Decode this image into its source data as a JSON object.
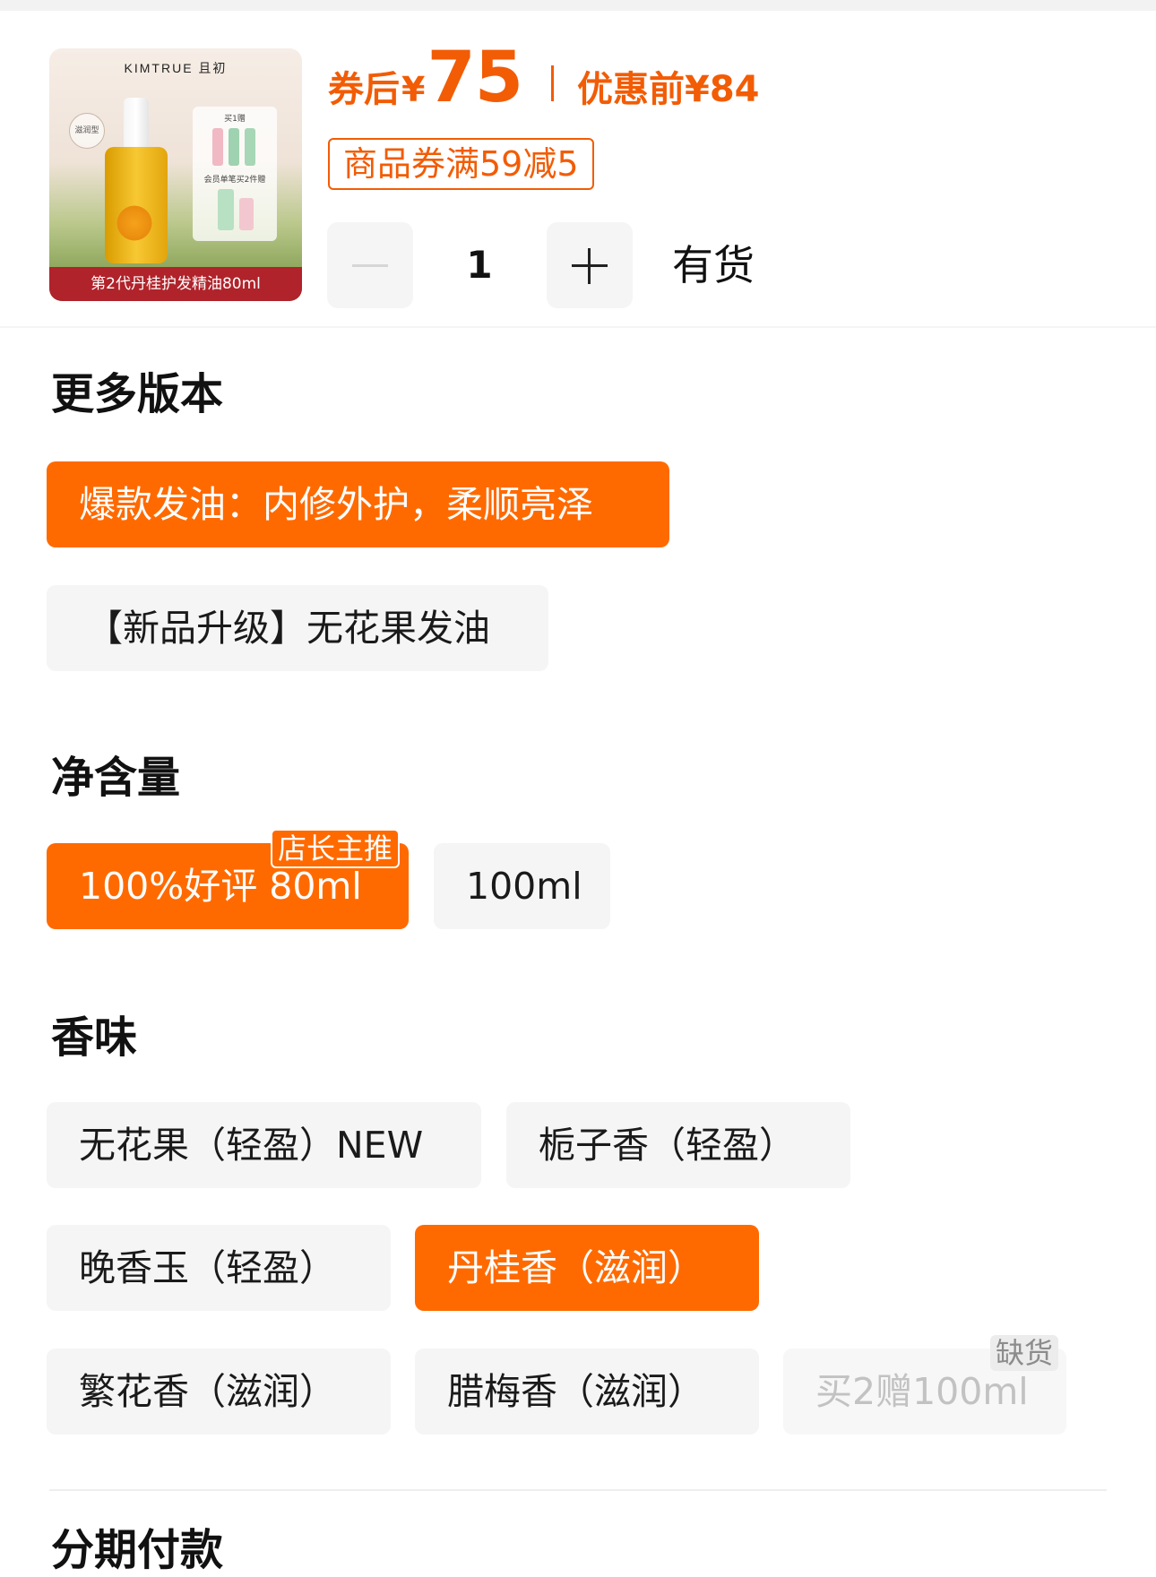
{
  "product": {
    "thumbnail": {
      "brand": "KIMTRUE 且初",
      "round_tag": "滋润型",
      "panel_top": "买1赠",
      "panel_mid": "会员单笔买2件赠",
      "caption": "第2代丹桂护发精油80ml"
    },
    "price": {
      "label": "券后",
      "currency": "¥",
      "value": "75",
      "orig_label": "优惠前",
      "orig_currency": "¥",
      "orig_value": "84"
    },
    "coupon": "商品券满59减5",
    "quantity": "1",
    "stock": "有货"
  },
  "sections": {
    "version": {
      "title": "更多版本",
      "options": [
        "爆款发油：内修外护，柔顺亮泽",
        "【新品升级】无花果发油"
      ]
    },
    "volume": {
      "title": "净含量",
      "options": [
        "100%好评 80ml",
        "100ml"
      ],
      "badge": "店长主推"
    },
    "scent": {
      "title": "香味",
      "options": [
        "无花果（轻盈）NEW",
        "栀子香（轻盈）",
        "晚香玉（轻盈）",
        "丹桂香（滋润）",
        "繁花香（滋润）",
        "腊梅香（滋润）",
        "买2赠100ml"
      ],
      "out_badge": "缺货"
    },
    "next": {
      "title": "分期付款"
    }
  },
  "colors": {
    "accent": "#ff6a00",
    "price": "#f25c05",
    "chip_bg": "#f5f5f5",
    "caption_bg": "#b0232b"
  }
}
